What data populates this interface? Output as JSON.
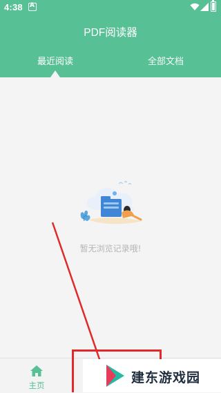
{
  "status_bar": {
    "time": "4:38",
    "notification_icon": "A",
    "icons": [
      "wifi-icon",
      "signal-icon",
      "battery-icon"
    ]
  },
  "app": {
    "title": "PDF阅读器"
  },
  "tabs": [
    {
      "label": "最近阅读",
      "selected": true
    },
    {
      "label": "全部文档",
      "selected": false
    }
  ],
  "empty_state": {
    "illustration": "reading-illustration",
    "message": "暂无浏览记录哦!"
  },
  "bottom_nav": {
    "items": [
      {
        "label": "主页",
        "icon": "home-icon",
        "selected": true
      }
    ]
  },
  "watermark": {
    "text": "建东游戏园"
  },
  "colors": {
    "primary": "#57c095",
    "annotation_red": "#e02a2a",
    "muted_text": "#b5b5b5",
    "background": "#f4f4f4"
  }
}
